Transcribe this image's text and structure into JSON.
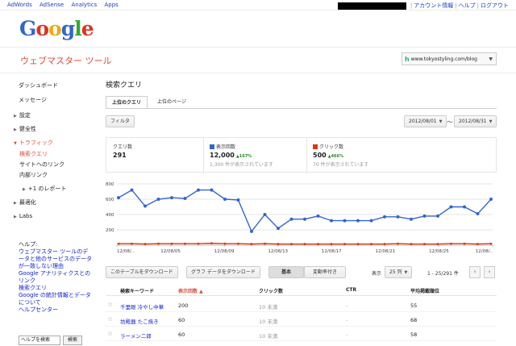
{
  "topbar": {
    "links": [
      "AdWords",
      "AdSense",
      "Analytics",
      "Apps"
    ],
    "right_links": [
      "アカウント情報",
      "ヘルプ",
      "ログアウト"
    ]
  },
  "logo_text": [
    "G",
    "o",
    "o",
    "g",
    "l",
    "e"
  ],
  "header": {
    "app_title": "ウェブマスター ツール",
    "site": "www.tokyostyling.com/blog"
  },
  "sidebar": {
    "dashboard": "ダッシュボード",
    "messages": "メッセージ",
    "settings": "設定",
    "health": "健全性",
    "traffic": "トラフィック",
    "search_queries": "検索クエリ",
    "links_to_site": "サイトへのリンク",
    "internal_links": "内部リンク",
    "plus_one": "+1 のレポート",
    "optimization": "最適化",
    "labs": "Labs",
    "help": {
      "heading": "ヘルプ:",
      "links": [
        "ウェブマスター ツールのデータと他のサービスのデータが一致しない理由",
        "Google アナリティクスとのリンク",
        "検索クエリ",
        "Google の統計情報とデータについて",
        "ヘルプセンター"
      ],
      "search_value": "ヘルプを検索",
      "search_button": "検索"
    }
  },
  "main": {
    "title": "検索クエリ",
    "tabs": [
      "上位のクエリ",
      "上位のページ"
    ],
    "filter_button": "フィルタ",
    "date_from": "2012/08/01",
    "date_sep": "〜",
    "date_to": "2012/08/31",
    "stats": {
      "queries_label": "クエリ数",
      "queries_value": "291",
      "impressions_label": "表示回数",
      "impressions_value": "12,000",
      "impressions_change": "167%",
      "impressions_note": "1,300 件が表示されています",
      "clicks_label": "クリック数",
      "clicks_value": "500",
      "clicks_change": "466%",
      "clicks_note": "70 件が表示されています"
    },
    "download_table": "このテーブルをダウンロード",
    "download_chart": "グラフ データをダウンロード",
    "view_basic": "基本",
    "view_change": "変動率付き",
    "show_label": "表示",
    "rows_select": "25 列",
    "range_text": "1 - 25/291 件",
    "table_headers": [
      "検索キーワード",
      "表示回数 ▲",
      "クリック数",
      "CTR",
      "平均掲載順位"
    ],
    "rows": [
      {
        "keyword": "千里眼 冷やし中華",
        "impressions": "200",
        "clicks": "10 未満",
        "ctr": "-",
        "position": "55"
      },
      {
        "keyword": "坊殿器 たこ焼き",
        "impressions": "60",
        "clicks": "10 未満",
        "ctr": "-",
        "position": "68"
      },
      {
        "keyword": "ラーメン二郎",
        "impressions": "60",
        "clicks": "10 未満",
        "ctr": "-",
        "position": "58"
      }
    ]
  },
  "colors": {
    "impressions": "#3366cc",
    "clicks": "#dc3912",
    "accent": "#dd4b39"
  },
  "chart_data": {
    "type": "line",
    "ylim": [
      0,
      800
    ],
    "y_ticks": [
      "800",
      "600",
      "400",
      "200"
    ],
    "x_tick_labels": [
      "12/08/..",
      "12/08/05",
      "12/08/09",
      "12/08/13",
      "12/08/17",
      "12/08/21",
      "12/08/25",
      "12/08/.."
    ],
    "series": [
      {
        "name": "表示回数",
        "values": [
          620,
          720,
          510,
          600,
          620,
          610,
          720,
          720,
          600,
          590,
          180,
          400,
          220,
          340,
          340,
          380,
          320,
          320,
          320,
          320,
          370,
          370,
          340,
          380,
          380,
          500,
          500,
          410,
          600
        ]
      },
      {
        "name": "クリック数",
        "values": [
          20,
          20,
          15,
          20,
          20,
          20,
          20,
          25,
          20,
          20,
          15,
          20,
          15,
          15,
          15,
          15,
          15,
          15,
          15,
          15,
          15,
          20,
          15,
          15,
          15,
          20,
          20,
          15,
          20
        ]
      }
    ]
  }
}
